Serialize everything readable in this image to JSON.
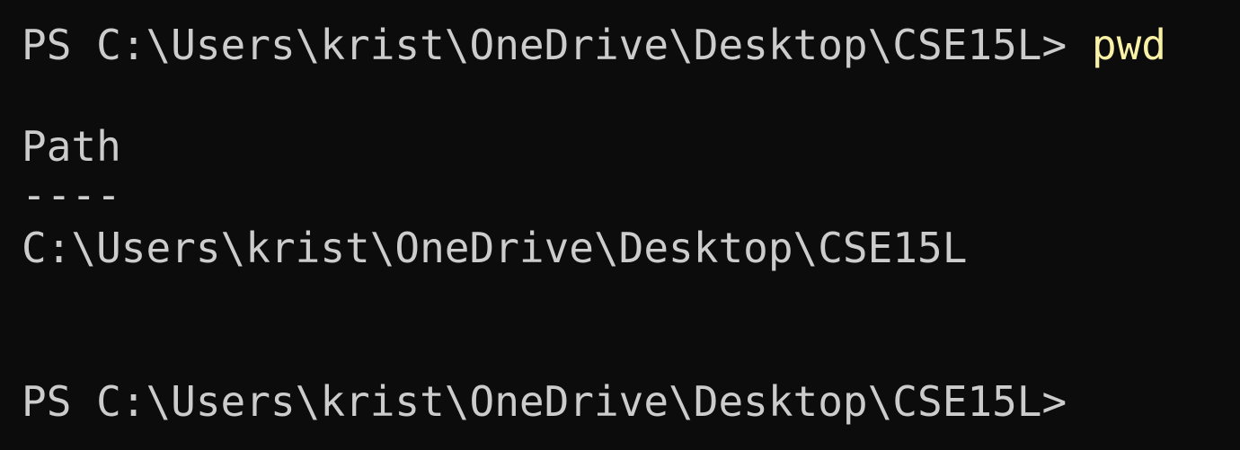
{
  "terminal": {
    "prompt": "PS C:\\Users\\krist\\OneDrive\\Desktop\\CSE15L>",
    "command": "pwd",
    "output_header": "Path",
    "output_separator": "----",
    "output_value": "C:\\Users\\krist\\OneDrive\\Desktop\\CSE15L",
    "prompt_second": "PS C:\\Users\\krist\\OneDrive\\Desktop\\CSE15L>"
  },
  "colors": {
    "background": "#0c0c0c",
    "text": "#cccccc",
    "command": "#f9f1a5"
  }
}
